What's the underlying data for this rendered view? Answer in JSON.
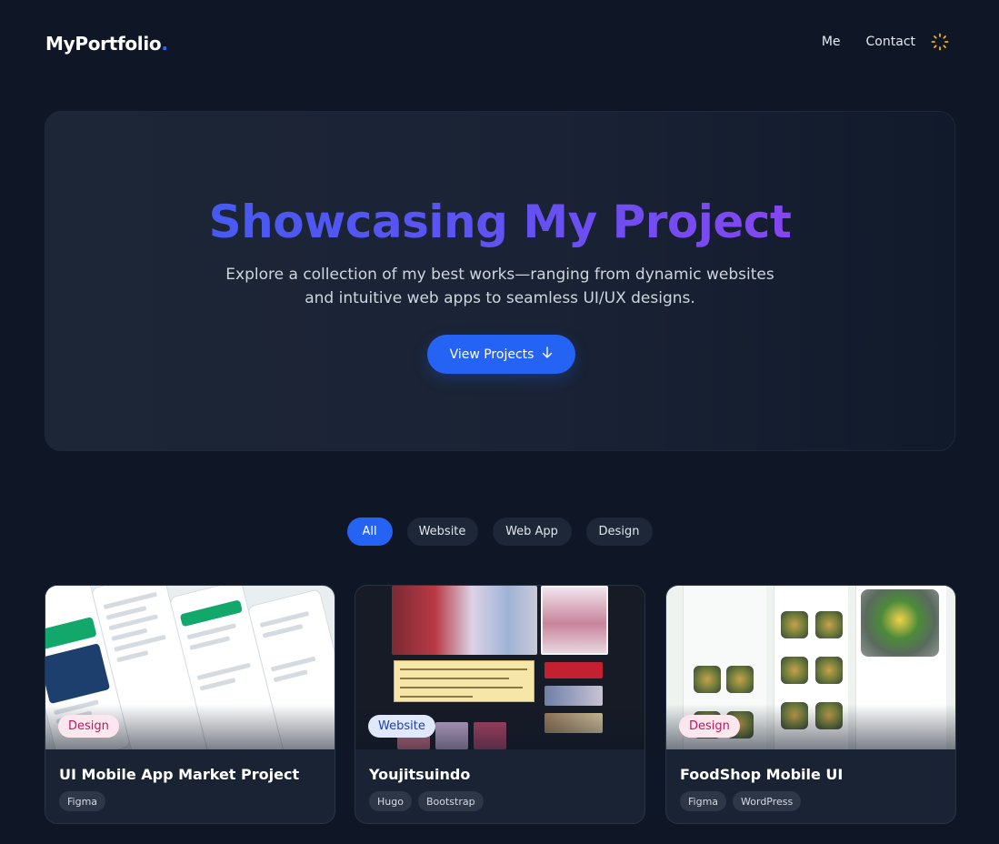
{
  "header": {
    "logo_text": "MyPortfolio",
    "logo_dot": ".",
    "nav": [
      {
        "label": "Me"
      },
      {
        "label": "Contact"
      }
    ],
    "theme_icon": "loader-icon"
  },
  "hero": {
    "title": "Showcasing My Project",
    "subtitle": "Explore a collection of my best works—ranging from dynamic websites and intuitive web apps to seamless UI/UX designs.",
    "button_label": "View Projects",
    "button_icon": "arrow-down-icon",
    "title_gradient": [
      "#3a5df0",
      "#9a3ff0"
    ]
  },
  "filters": {
    "items": [
      {
        "label": "All",
        "active": true
      },
      {
        "label": "Website",
        "active": false
      },
      {
        "label": "Web App",
        "active": false
      },
      {
        "label": "Design",
        "active": false
      }
    ]
  },
  "projects": [
    {
      "category": "Design",
      "title": "UI Mobile App Market Project",
      "tags": [
        "Figma"
      ]
    },
    {
      "category": "Website",
      "title": "Youjitsuindo",
      "tags": [
        "Hugo",
        "Bootstrap"
      ]
    },
    {
      "category": "Design",
      "title": "FoodShop Mobile UI",
      "tags": [
        "Figma",
        "WordPress"
      ]
    }
  ],
  "colors": {
    "background": "#0f1727",
    "accent": "#2563f5",
    "card": "#1a2334",
    "design_badge_text": "#be185d",
    "website_badge_text": "#1e40af"
  }
}
